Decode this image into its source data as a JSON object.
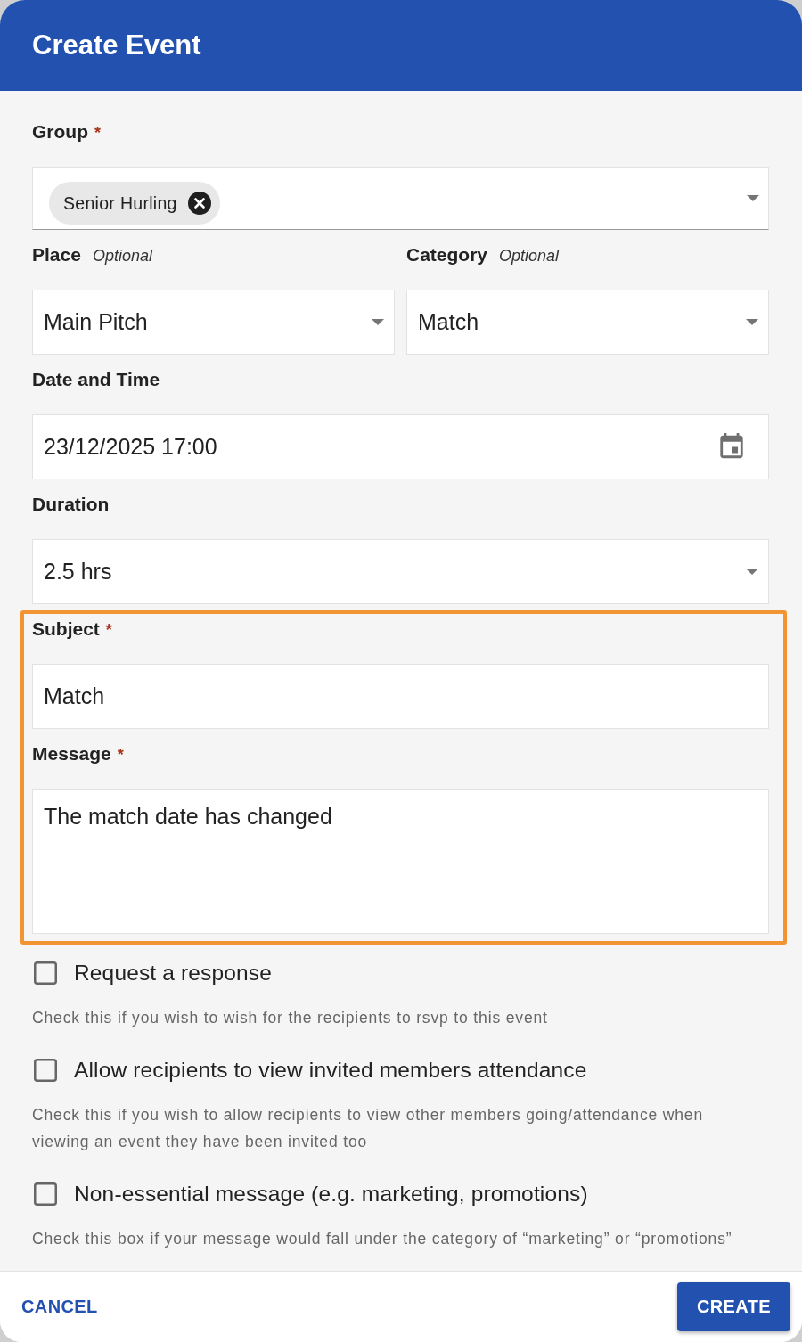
{
  "dialog": {
    "title": "Create Event"
  },
  "fields": [
    {
      "kind": "chips",
      "label": "Group",
      "required_mark": "*",
      "chips": [
        "Senior Hurling"
      ],
      "highlighted": false
    },
    {
      "kind": "row",
      "highlighted": false,
      "fields": [
        {
          "kind": "select",
          "label": "Place",
          "hint": "Optional",
          "value": "Main Pitch"
        },
        {
          "kind": "select",
          "label": "Category",
          "hint": "Optional",
          "value": "Match"
        }
      ]
    },
    {
      "kind": "date",
      "label": "Date and Time",
      "value": "23/12/2025 17:00",
      "highlighted": false
    },
    {
      "kind": "select",
      "label": "Duration",
      "value": "2.5 hrs",
      "highlighted": false
    },
    {
      "kind": "text",
      "label": "Subject",
      "required_mark": "*",
      "value": "Match",
      "highlighted": true
    },
    {
      "kind": "textarea",
      "label": "Message",
      "required_mark": "*",
      "value": "The match date has changed",
      "highlighted": true
    }
  ],
  "options": [
    {
      "label": "Request a response",
      "checked": false,
      "help": "Check this if you wish to wish for the recipients to rsvp to this event"
    },
    {
      "label": "Allow recipients to view invited members attendance",
      "checked": false,
      "help": "Check this if you wish to allow recipients to view other members going/attendance when viewing an event they have been invited too"
    },
    {
      "label": "Non-essential message (e.g. marketing, promotions)",
      "checked": false,
      "help": "Check this box if your message would fall under the category of “marketing” or “promotions”"
    }
  ],
  "actions": [
    {
      "kind": "text",
      "label": "CANCEL"
    },
    {
      "kind": "contained",
      "label": "CREATE"
    }
  ]
}
